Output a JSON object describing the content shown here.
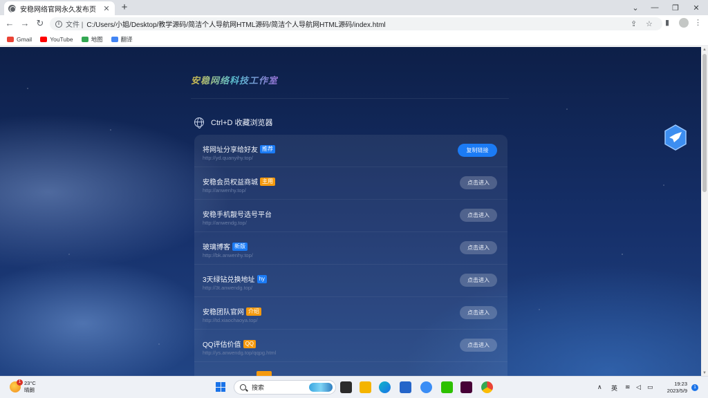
{
  "browser": {
    "tab_title": "安稳网络官网永久发布页",
    "tab_close": "✕",
    "new_tab": "+",
    "security_label": "文件 |",
    "url": "C:/Users/小姐/Desktop/教学源码/简洁个人导航网HTML源码/简洁个人导航网HTML源码/index.html",
    "bookmarks": [
      {
        "label": "Gmail",
        "icon": "gmail-icon",
        "color": "#ea4335"
      },
      {
        "label": "YouTube",
        "icon": "youtube-icon",
        "color": "#ff0000"
      },
      {
        "label": "地图",
        "icon": "maps-icon",
        "color": "#34a853"
      },
      {
        "label": "翻译",
        "icon": "translate-icon",
        "color": "#4285f4"
      }
    ]
  },
  "page": {
    "logo_text": "安稳网络科技工作室",
    "section_title": "Ctrl+D 收藏浏览器",
    "items": [
      {
        "name": "将网址分享给好友",
        "badge": "推荐",
        "badge_color": "#1b7bf5",
        "link": "http://yd.quanyihy.top/",
        "button": "复制链接",
        "primary": true
      },
      {
        "name": "安稳会员权益商城",
        "badge": "主用",
        "badge_color": "#f59a0e",
        "link": "http://anwenhy.top/",
        "button": "点击进入",
        "primary": false
      },
      {
        "name": "安稳手机靓号选号平台",
        "badge": "",
        "badge_color": "",
        "link": "http://anwendg.top/",
        "button": "点击进入",
        "primary": false
      },
      {
        "name": "玻璃博客",
        "badge": "新版",
        "badge_color": "#1b7bf5",
        "link": "http://bk.anwenhy.top/",
        "button": "点击进入",
        "primary": false
      },
      {
        "name": "3天绿钻兑换地址",
        "badge": "hy",
        "badge_color": "#1b7bf5",
        "link": "http://3t.anwendg.top/",
        "button": "点击进入",
        "primary": false
      },
      {
        "name": "安稳团队官网",
        "badge": "介绍",
        "badge_color": "#f59a0e",
        "link": "http://td.xiaochaoya.top/",
        "button": "点击进入",
        "primary": false
      },
      {
        "name": "QQ评估价值",
        "badge": "QQ",
        "badge_color": "#f59a0e",
        "link": "http://ys.anwendg.top/qqpg.html",
        "button": "点击进入",
        "primary": false
      }
    ]
  },
  "taskbar": {
    "temperature": "23°C",
    "weather": "晴朗",
    "weather_badge": "1",
    "search_label": "搜索",
    "ime": "英",
    "time": "19:23",
    "date": "2023/5/9",
    "notification_count": "1"
  }
}
